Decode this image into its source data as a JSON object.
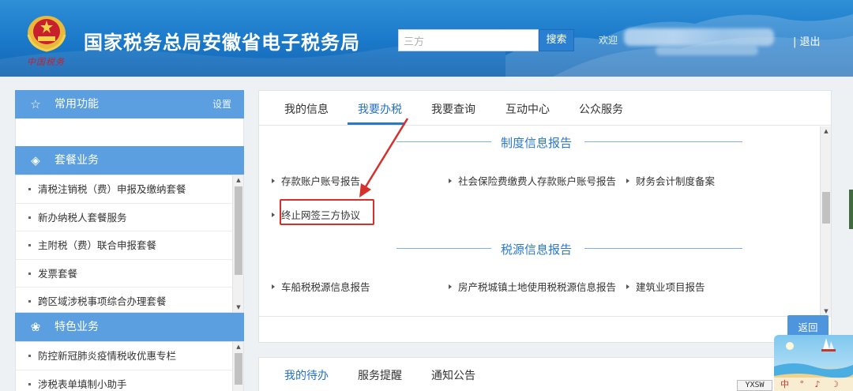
{
  "header": {
    "emblem_text": "中国税务",
    "site_title": "国家税务总局安徽省电子税务局",
    "search": {
      "value": "三方",
      "button": "搜索"
    },
    "welcome": "欢迎",
    "logout": "| 退出"
  },
  "sidebar": {
    "common": {
      "label": "常用功能",
      "settings": "设置",
      "icon": "star-outline-icon"
    },
    "package": {
      "label": "套餐业务",
      "icon": "layers-icon",
      "items": [
        "清税注销税（费）申报及缴纳套餐",
        "新办纳税人套餐服务",
        "主附税（费）联合申报套餐",
        "发票套餐",
        "跨区域涉税事项综合办理套餐"
      ]
    },
    "special": {
      "label": "特色业务",
      "icon": "grid-flower-icon",
      "items": [
        "防控新冠肺炎疫情税收优惠专栏",
        "涉税表单填制小助手"
      ]
    }
  },
  "main": {
    "tabs": [
      "我的信息",
      "我要办税",
      "我要查询",
      "互动中心",
      "公众服务"
    ],
    "active_tab": "我要办税",
    "sections": [
      {
        "title": "制度信息报告",
        "links": [
          "存款账户账号报告",
          "社会保险费缴费人存款账户账号报告",
          "财务会计制度备案",
          "终止网签三方协议"
        ]
      },
      {
        "title": "税源信息报告",
        "links": [
          "车船税税源信息报告",
          "房产税城镇土地使用税税源信息报告",
          "建筑业项目报告"
        ]
      }
    ],
    "highlighted_link": "终止网签三方协议",
    "return_button": "返回"
  },
  "bottom_panel": {
    "tabs": [
      "我的待办",
      "服务提醒",
      "通知公告"
    ],
    "active_tab": "我的待办"
  },
  "ime": {
    "label": "YXSW",
    "bar": "中 ° ♪ ☽ 👕"
  },
  "colors": {
    "header_blue": "#1a78c9",
    "sidebar_head": "#5b9fe0",
    "accent_blue": "#2a78cc",
    "highlight_red": "#d6302b"
  }
}
